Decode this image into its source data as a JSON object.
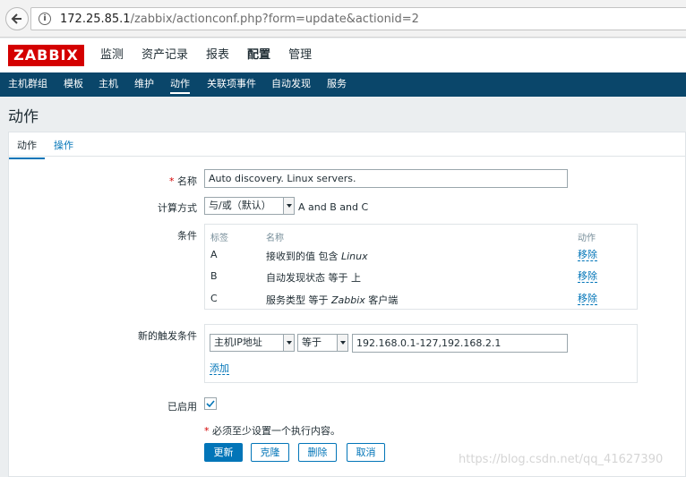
{
  "browser": {
    "url_host": "172.25.85.1",
    "url_path": "/zabbix/actionconf.php?form=update&actionid=2"
  },
  "brand": {
    "logo_text": "ZABBIX",
    "logo_color": "#d40000"
  },
  "top_menu": [
    {
      "label": "监测"
    },
    {
      "label": "资产记录"
    },
    {
      "label": "报表"
    },
    {
      "label": "配置",
      "selected": true
    },
    {
      "label": "管理"
    }
  ],
  "sub_menu": [
    {
      "label": "主机群组"
    },
    {
      "label": "模板"
    },
    {
      "label": "主机"
    },
    {
      "label": "维护"
    },
    {
      "label": "动作",
      "selected": true
    },
    {
      "label": "关联项事件"
    },
    {
      "label": "自动发现"
    },
    {
      "label": "服务"
    }
  ],
  "page_title": "动作",
  "tabs": [
    {
      "label": "动作",
      "active": true
    },
    {
      "label": "操作",
      "active": false
    }
  ],
  "form": {
    "name_label": "名称",
    "name_required_mark": "*",
    "name_value": "Auto discovery. Linux servers.",
    "calc_label": "计算方式",
    "calc_select": "与/或（默认）",
    "calc_expression": "A and B and C",
    "conditions_label": "条件",
    "conditions_headers": {
      "label": "标签",
      "name": "名称",
      "action": "动作"
    },
    "conditions": [
      {
        "label": "A",
        "name_prefix": "接收到的值 包含 ",
        "name_em": "Linux",
        "name_suffix": "",
        "action": "移除"
      },
      {
        "label": "B",
        "name_prefix": "自动发现状态 等于 ",
        "name_em": "",
        "name_suffix": "上",
        "action": "移除"
      },
      {
        "label": "C",
        "name_prefix": "服务类型 等于 ",
        "name_em": "Zabbix",
        "name_suffix": " 客户端",
        "action": "移除"
      }
    ],
    "new_condition_label": "新的触发条件",
    "new_condition_type": "主机IP地址",
    "new_condition_operator": "等于",
    "new_condition_value": "192.168.0.1-127,192.168.2.1",
    "add_link": "添加",
    "enabled_label": "已启用",
    "enabled": true,
    "warning_mark": "*",
    "warning_text": "必须至少设置一个执行内容。",
    "buttons": {
      "update": "更新",
      "clone": "克隆",
      "delete": "删除",
      "cancel": "取消"
    }
  },
  "colors": {
    "subnav_bg": "#0a466a",
    "link": "#0275b8",
    "required": "#d40000"
  },
  "watermark": "https://blog.csdn.net/qq_41627390"
}
